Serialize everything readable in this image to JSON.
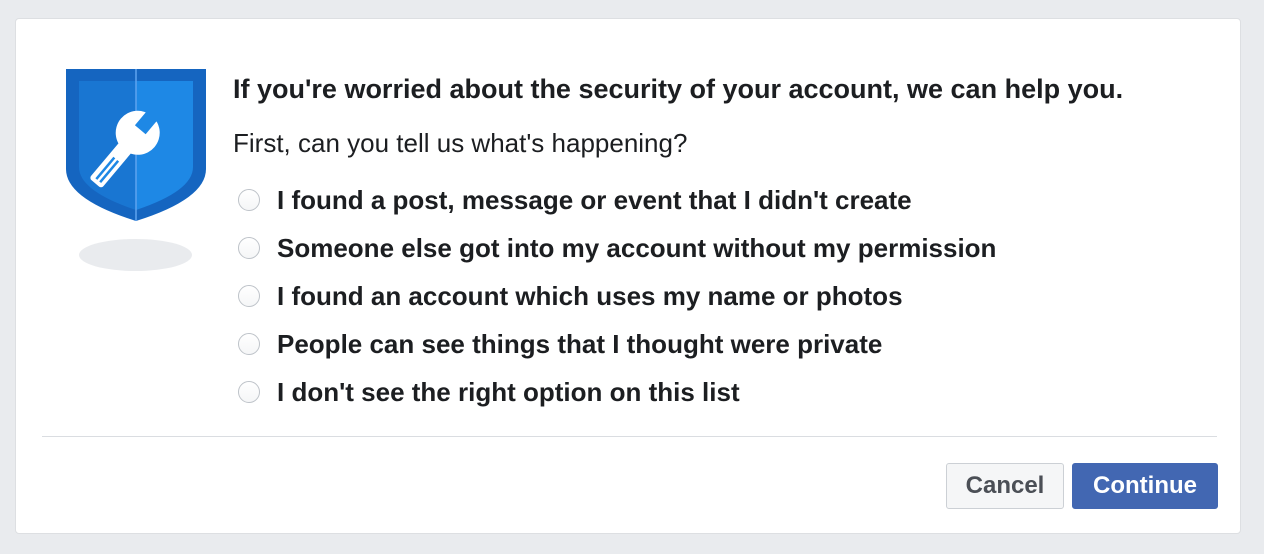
{
  "dialog": {
    "icon": "shield-wrench-icon",
    "headline": "If you're worried about the security of your account, we can help you.",
    "question": "First, can you tell us what's happening?",
    "options": [
      {
        "label": "I found a post, message or event that I didn't create",
        "selected": false
      },
      {
        "label": "Someone else got into my account without my permission",
        "selected": false
      },
      {
        "label": "I found an account which uses my name or photos",
        "selected": false
      },
      {
        "label": "People can see things that I thought were private",
        "selected": false
      },
      {
        "label": "I don't see the right option on this list",
        "selected": false
      }
    ],
    "buttons": {
      "cancel": "Cancel",
      "continue": "Continue"
    }
  },
  "colors": {
    "shield_dark": "#1565c0",
    "shield_light": "#1e88e5",
    "primary_button": "#4267b2",
    "page_background": "#e9ebee"
  }
}
